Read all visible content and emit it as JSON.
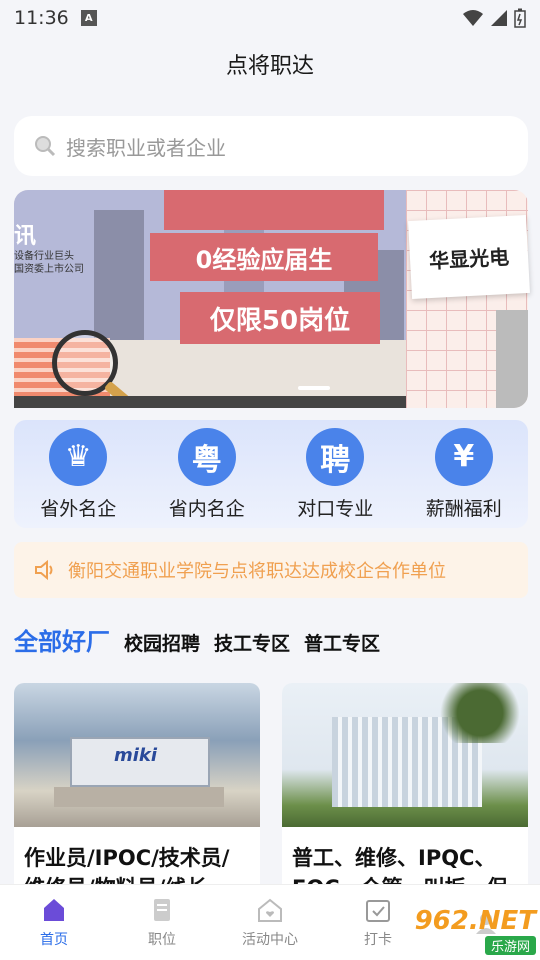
{
  "status_bar": {
    "time": "11:36",
    "sim_label": "A"
  },
  "app": {
    "title": "点将职达"
  },
  "search": {
    "placeholder": "搜索职业或者企业"
  },
  "banner": {
    "headline1": "0经验应届生",
    "headline2": "仅限50岗位",
    "side_company": "华显光电",
    "corner_text_big": "讯",
    "corner_text_line1": "设备行业巨头",
    "corner_text_line2": "国资委上市公司"
  },
  "categories": [
    {
      "label": "省外名企",
      "icon": "crown-icon",
      "glyph": "♛"
    },
    {
      "label": "省内名企",
      "icon": "yue-icon",
      "glyph": "粤"
    },
    {
      "label": "对口专业",
      "icon": "pin-icon",
      "glyph": "聘"
    },
    {
      "label": "薪酬福利",
      "icon": "money-bag-icon",
      "glyph": "¥"
    }
  ],
  "notice": {
    "text": "衡阳交通职业学院与点将职达达成校企合作单位"
  },
  "tabs": {
    "active": "全部好厂",
    "items": [
      "校园招聘",
      "技工专区",
      "普工专区"
    ]
  },
  "jobs": [
    {
      "title": "作业员/IPOC/技术员/维修员/物料员/线长",
      "image_text": "miki"
    },
    {
      "title": "普工、维修、IPQC、FQC、仓管、叫扳、保安"
    }
  ],
  "bottom_nav": [
    {
      "label": "首页",
      "icon": "home-icon"
    },
    {
      "label": "职位",
      "icon": "doc-icon"
    },
    {
      "label": "活动中心",
      "icon": "activity-icon"
    },
    {
      "label": "打卡",
      "icon": "checkin-icon"
    }
  ],
  "watermark": {
    "main": "962.NET",
    "sub": "乐游网"
  },
  "colors": {
    "accent": "#2b6de8",
    "notice_text": "#f0a050",
    "category_circle": "#4a83ea"
  }
}
